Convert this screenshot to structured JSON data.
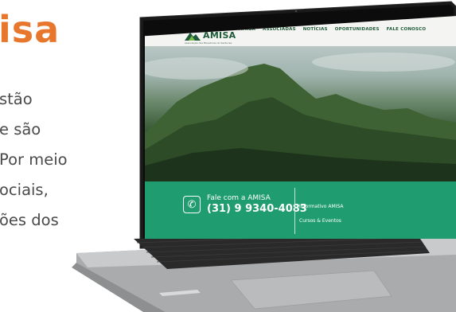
{
  "page": {
    "headline": "isa",
    "body_lines": [
      "stão",
      "e são",
      "Por meio",
      "ociais,",
      "ões dos"
    ]
  },
  "website": {
    "logo_text": "AMISA",
    "logo_subtitle": "Associação dos Moradores do Santa Isa",
    "nav": [
      "AMISA",
      "ASSOCIADAS",
      "NOTÍCIAS",
      "OPORTUNIDADES",
      "FALE CONOSCO"
    ],
    "contact_label": "Fale com a AMISA",
    "phone_number": "(31) 9 9340-4083",
    "band_links": [
      "Informativo AMISA",
      "Cursos & Eventos"
    ],
    "brand_green": "#1f9d71",
    "accent_orange": "#e8772e",
    "icons": [
      "phone-icon",
      "mountain-logo-icon"
    ]
  }
}
